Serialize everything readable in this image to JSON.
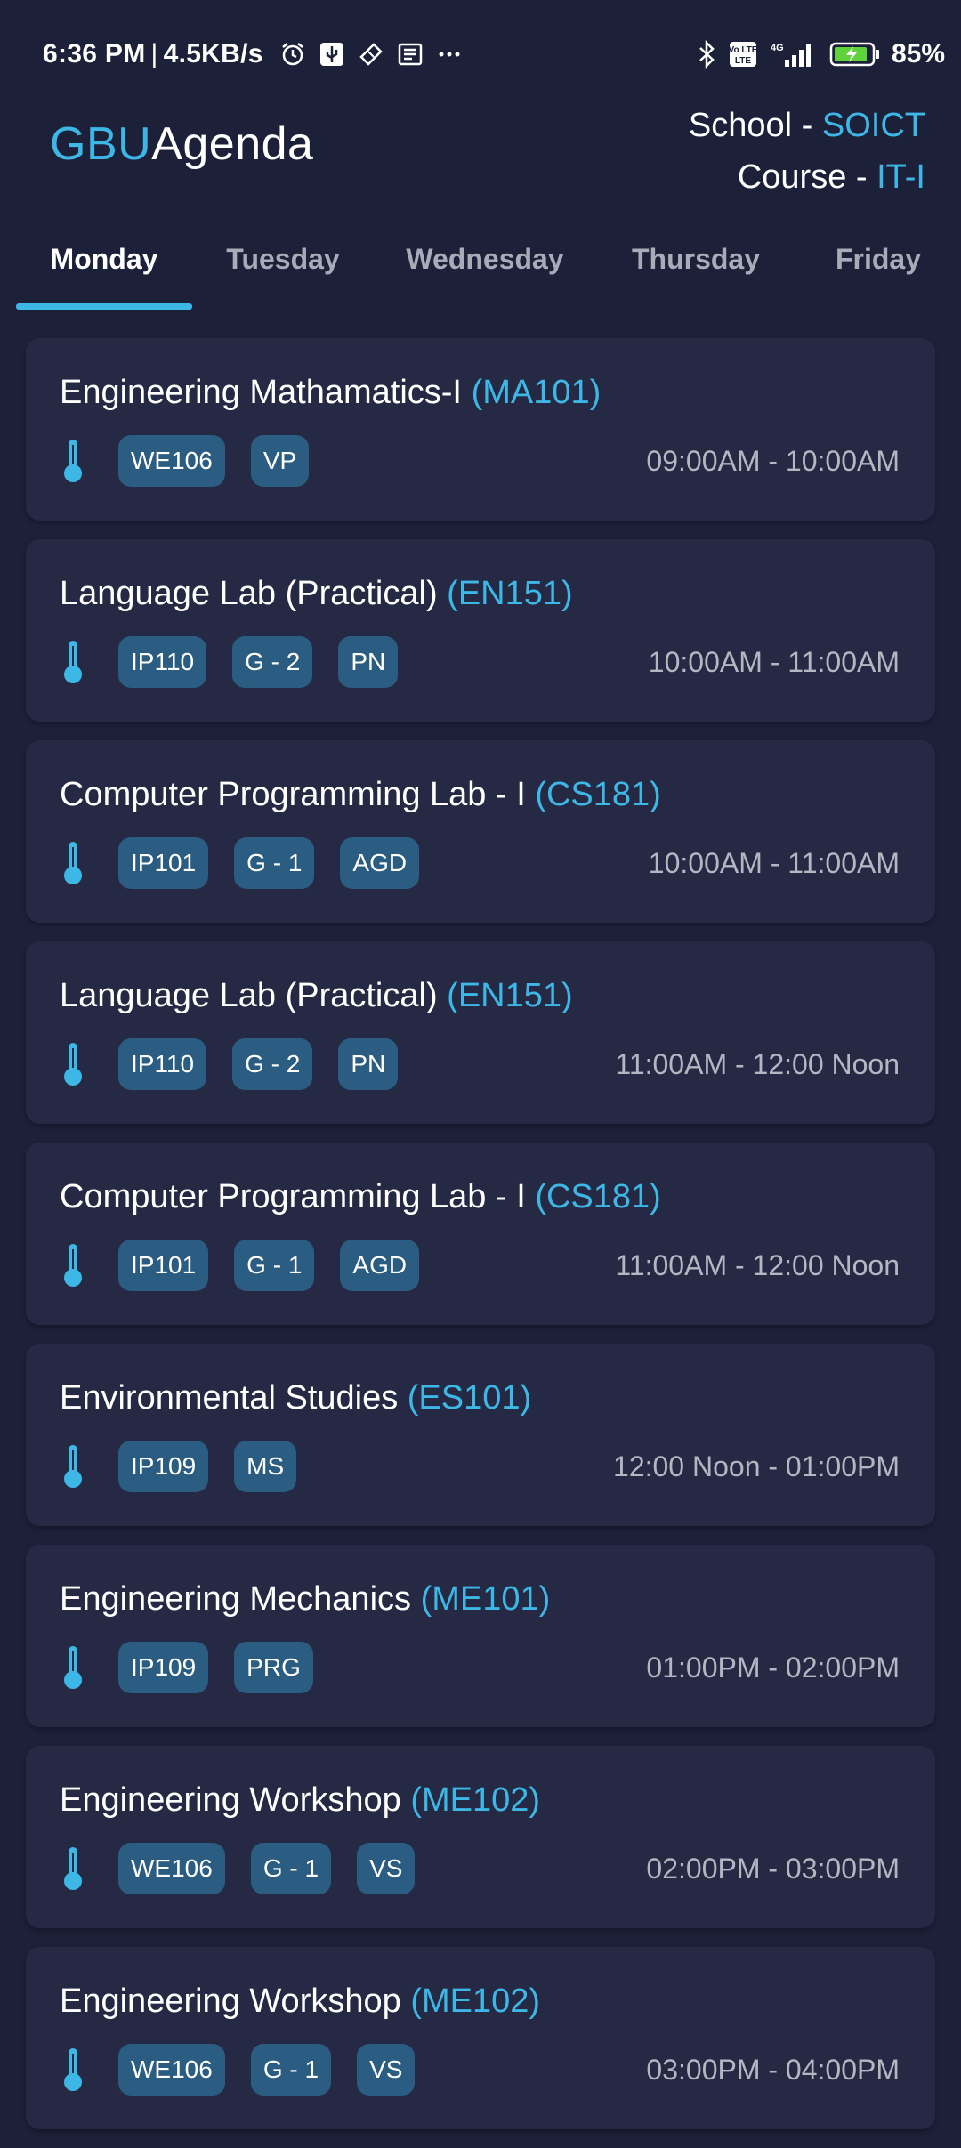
{
  "status_bar": {
    "time": "6:36 PM",
    "separator": "|",
    "speed": "4.5KB/s",
    "left_icons": [
      "alarm-icon",
      "usb-icon",
      "ticket-icon",
      "news-icon",
      "more-dots-icon"
    ],
    "battery": "85%",
    "volte_label": "Vo LTE",
    "network_label": "4G"
  },
  "header": {
    "title_accent": "GBU",
    "title_rest": "Agenda",
    "school_label": "School - ",
    "school_value": "SOICT",
    "course_label": "Course - ",
    "course_value": "IT-I"
  },
  "tabs": [
    {
      "label": "Monday",
      "active": true
    },
    {
      "label": "Tuesday",
      "active": false
    },
    {
      "label": "Wednesday",
      "active": false
    },
    {
      "label": "Thursday",
      "active": false
    },
    {
      "label": "Friday",
      "active": false
    }
  ],
  "classes": [
    {
      "subject": "Engineering Mathamatics-I",
      "code": "(MA101)",
      "tags": [
        "WE106",
        "VP"
      ],
      "time": "09:00AM - 10:00AM",
      "icon": "thermometer-icon"
    },
    {
      "subject": "Language Lab (Practical)",
      "code": "(EN151)",
      "tags": [
        "IP110",
        "G - 2",
        "PN"
      ],
      "time": "10:00AM - 11:00AM",
      "icon": "thermometer-icon"
    },
    {
      "subject": "Computer Programming Lab - I",
      "code": "(CS181)",
      "tags": [
        "IP101",
        "G - 1",
        "AGD"
      ],
      "time": "10:00AM - 11:00AM",
      "icon": "thermometer-icon"
    },
    {
      "subject": "Language Lab (Practical)",
      "code": "(EN151)",
      "tags": [
        "IP110",
        "G - 2",
        "PN"
      ],
      "time": "11:00AM - 12:00 Noon",
      "icon": "thermometer-icon"
    },
    {
      "subject": "Computer Programming Lab - I",
      "code": "(CS181)",
      "tags": [
        "IP101",
        "G - 1",
        "AGD"
      ],
      "time": "11:00AM - 12:00 Noon",
      "icon": "thermometer-icon"
    },
    {
      "subject": "Environmental Studies",
      "code": "(ES101)",
      "tags": [
        "IP109",
        "MS"
      ],
      "time": "12:00 Noon - 01:00PM",
      "icon": "thermometer-icon"
    },
    {
      "subject": "Engineering Mechanics",
      "code": "(ME101)",
      "tags": [
        "IP109",
        "PRG"
      ],
      "time": "01:00PM - 02:00PM",
      "icon": "thermometer-icon"
    },
    {
      "subject": "Engineering Workshop",
      "code": "(ME102)",
      "tags": [
        "WE106",
        "G - 1",
        "VS"
      ],
      "time": "02:00PM - 03:00PM",
      "icon": "thermometer-icon"
    },
    {
      "subject": "Engineering Workshop",
      "code": "(ME102)",
      "tags": [
        "WE106",
        "G - 1",
        "VS"
      ],
      "time": "03:00PM - 04:00PM",
      "icon": "thermometer-icon"
    }
  ],
  "colors": {
    "background": "#1c2039",
    "card": "#262944",
    "accent": "#3cb7e6",
    "chip": "#2b5c81",
    "time_text": "#b4b6c2",
    "inactive_tab": "#a9abb8"
  }
}
